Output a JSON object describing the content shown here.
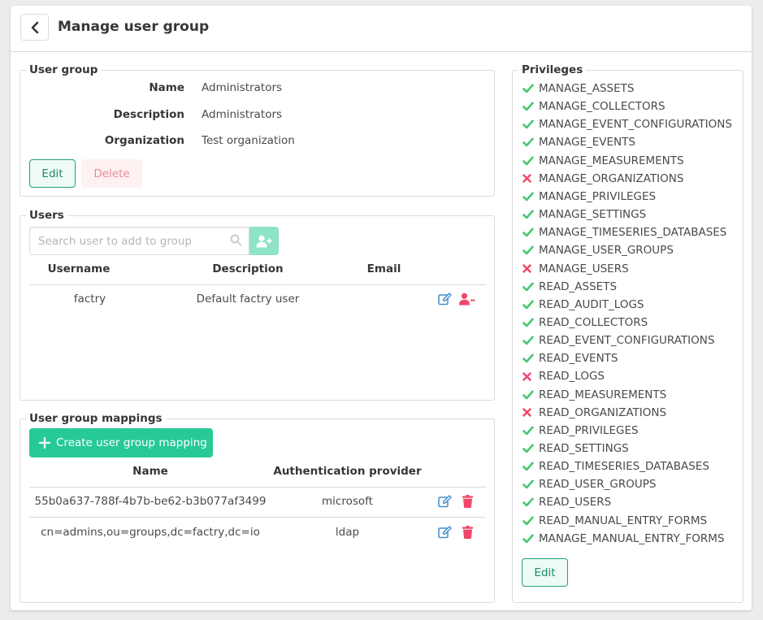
{
  "header": {
    "title": "Manage user group"
  },
  "user_group": {
    "legend": "User group",
    "fields": [
      {
        "label": "Name",
        "value": "Administrators"
      },
      {
        "label": "Description",
        "value": "Administrators"
      },
      {
        "label": "Organization",
        "value": "Test organization"
      }
    ],
    "edit_label": "Edit",
    "delete_label": "Delete"
  },
  "users": {
    "legend": "Users",
    "search_placeholder": "Search user to add to group",
    "columns": [
      "Username",
      "Description",
      "Email"
    ],
    "rows": [
      {
        "username": "factry",
        "description": "Default factry user",
        "email": ""
      }
    ]
  },
  "mappings": {
    "legend": "User group mappings",
    "create_label": "Create user group mapping",
    "columns": [
      "Name",
      "Authentication provider"
    ],
    "rows": [
      {
        "name": "55b0a637-788f-4b7b-be62-b3b077af3499",
        "provider": "microsoft"
      },
      {
        "name": "cn=admins,ou=groups,dc=factry,dc=io",
        "provider": "ldap"
      }
    ]
  },
  "privileges": {
    "legend": "Privileges",
    "items": [
      {
        "name": "MANAGE_ASSETS",
        "granted": true
      },
      {
        "name": "MANAGE_COLLECTORS",
        "granted": true
      },
      {
        "name": "MANAGE_EVENT_CONFIGURATIONS",
        "granted": true
      },
      {
        "name": "MANAGE_EVENTS",
        "granted": true
      },
      {
        "name": "MANAGE_MEASUREMENTS",
        "granted": true
      },
      {
        "name": "MANAGE_ORGANIZATIONS",
        "granted": false
      },
      {
        "name": "MANAGE_PRIVILEGES",
        "granted": true
      },
      {
        "name": "MANAGE_SETTINGS",
        "granted": true
      },
      {
        "name": "MANAGE_TIMESERIES_DATABASES",
        "granted": true
      },
      {
        "name": "MANAGE_USER_GROUPS",
        "granted": true
      },
      {
        "name": "MANAGE_USERS",
        "granted": false
      },
      {
        "name": "READ_ASSETS",
        "granted": true
      },
      {
        "name": "READ_AUDIT_LOGS",
        "granted": true
      },
      {
        "name": "READ_COLLECTORS",
        "granted": true
      },
      {
        "name": "READ_EVENT_CONFIGURATIONS",
        "granted": true
      },
      {
        "name": "READ_EVENTS",
        "granted": true
      },
      {
        "name": "READ_LOGS",
        "granted": false
      },
      {
        "name": "READ_MEASUREMENTS",
        "granted": true
      },
      {
        "name": "READ_ORGANIZATIONS",
        "granted": false
      },
      {
        "name": "READ_PRIVILEGES",
        "granted": true
      },
      {
        "name": "READ_SETTINGS",
        "granted": true
      },
      {
        "name": "READ_TIMESERIES_DATABASES",
        "granted": true
      },
      {
        "name": "READ_USER_GROUPS",
        "granted": true
      },
      {
        "name": "READ_USERS",
        "granted": true
      },
      {
        "name": "READ_MANUAL_ENTRY_FORMS",
        "granted": true
      },
      {
        "name": "MANAGE_MANUAL_ENTRY_FORMS",
        "granted": true
      }
    ],
    "edit_label": "Edit"
  },
  "colors": {
    "accent": "#27c997",
    "granted": "#48c774",
    "denied": "#f14668",
    "action_edit": "#3e8ed0",
    "action_delete": "#f14668"
  }
}
